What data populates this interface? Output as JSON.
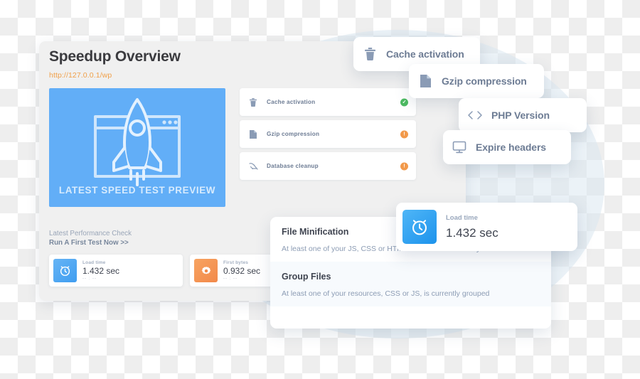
{
  "panel": {
    "title": "Speedup Overview",
    "url": "http://127.0.0.1/wp"
  },
  "preview": {
    "label": "LATEST SPEED TEST PREVIEW",
    "icon": "rocket-browser-illustration",
    "background_color": "#62aef7"
  },
  "checklist": {
    "items": [
      {
        "label": "Cache activation",
        "icon": "trash-icon",
        "status": "ok",
        "badge": "✓"
      },
      {
        "label": "Gzip compression",
        "icon": "document-icon",
        "status": "warn",
        "badge": "!"
      },
      {
        "label": "Database cleanup",
        "icon": "database-icon",
        "status": "warn",
        "badge": "!"
      }
    ]
  },
  "performance": {
    "heading": "Latest Performance Check",
    "link": "Run A First Test Now >>",
    "stats": [
      {
        "label": "Load time",
        "value": "1.432 sec",
        "sub": "-- : --",
        "icon": "alarm-clock-icon",
        "color": "#3f9df0"
      },
      {
        "label": "First bytes",
        "value": "0.932 sec",
        "sub": "-- : --",
        "icon": "gear-icon",
        "color": "#f2894a"
      }
    ]
  },
  "floating_cards": [
    {
      "label": "Cache activation",
      "icon": "trash-icon"
    },
    {
      "label": "Gzip compression",
      "icon": "document-icon"
    },
    {
      "label": "PHP Version",
      "icon": "code-brackets-icon"
    },
    {
      "label": "Expire headers",
      "icon": "monitor-icon"
    }
  ],
  "bottom_panel": {
    "sections": [
      {
        "title": "File Minification",
        "description": "At least one of your JS, CSS or HTML resources is currently minified"
      },
      {
        "title": "Group Files",
        "description": "At least one of your resources, CSS or JS, is currently grouped"
      }
    ]
  },
  "loadtime_card": {
    "label": "Load time",
    "value": "1.432 sec",
    "icon": "alarm-clock-icon"
  },
  "colors": {
    "accent_blue": "#62aef7",
    "accent_orange": "#f0a04a",
    "ok_green": "#4cba61",
    "warn_orange": "#f2994a",
    "panel_bg": "#f0f0f0",
    "icon_slate": "#8a9bb5"
  }
}
